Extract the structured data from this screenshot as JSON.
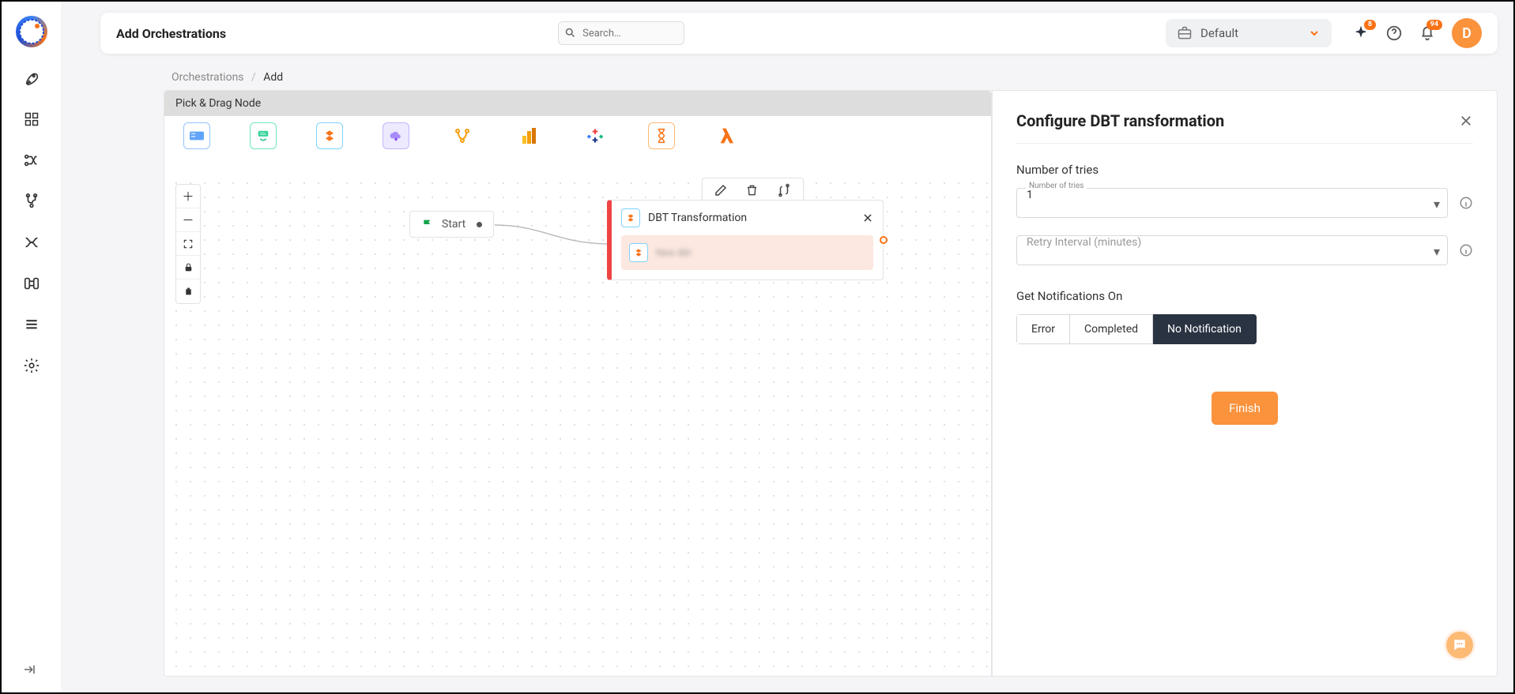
{
  "header": {
    "title": "Add Orchestrations",
    "search_placeholder": "Search…",
    "workspace_label": "Default",
    "sparkle_badge": "8",
    "bell_badge": "94",
    "avatar_initial": "D"
  },
  "breadcrumb": {
    "root": "Orchestrations",
    "current": "Add"
  },
  "palette": {
    "title": "Pick & Drag Node"
  },
  "canvas": {
    "start_label": "Start",
    "dbt_node_title": "DBT Transformation",
    "dbt_body_text": "New dbt"
  },
  "panel": {
    "title": "Configure DBT ransformation",
    "tries_section": "Number of tries",
    "tries_field_label": "Number of tries",
    "tries_value": "1",
    "retry_placeholder": "Retry Interval (minutes)",
    "notif_section": "Get Notifications On",
    "notif_options": {
      "error": "Error",
      "completed": "Completed",
      "none": "No Notification"
    },
    "finish_label": "Finish"
  }
}
